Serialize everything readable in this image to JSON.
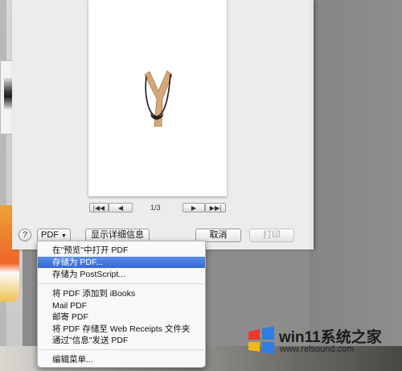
{
  "preview": {
    "page_indicator": "1/3",
    "nav": {
      "first": "|◀◀",
      "prev": "◀",
      "next": "▶",
      "last": "▶▶|"
    }
  },
  "buttons": {
    "help": "?",
    "pdf": "PDF",
    "show_details": "显示详细信息",
    "cancel": "取消",
    "print": "打印"
  },
  "pdf_menu": {
    "items": [
      "在\"预览\"中打开 PDF",
      "存储为 PDF...",
      "存储为 PostScript...",
      "将 PDF 添加到 iBooks",
      "Mail PDF",
      "邮寄 PDF",
      "将 PDF 存储至 Web Receipts 文件夹",
      "通过\"信息\"发送 PDF",
      "编辑菜单..."
    ],
    "highlighted_index": 1
  },
  "watermark": {
    "title": "win11系统之家",
    "url": "www.relsound.com"
  },
  "colors": {
    "highlight": "#3a6ed9",
    "logo_red": "#e8392d",
    "logo_yellow": "#f5b915",
    "logo_blue": "#2e7de1"
  }
}
